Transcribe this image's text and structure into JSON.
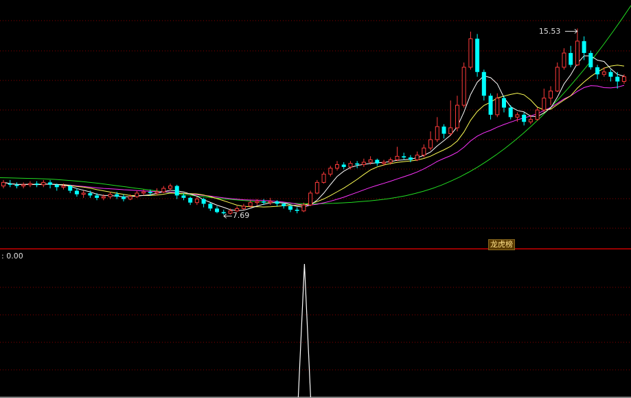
{
  "chart_data": [
    {
      "type": "candlestick",
      "labels": {
        "high": "15.53",
        "low": "7.69",
        "event": "龙虎榜"
      },
      "price_range": [
        6.6,
        16.5
      ],
      "colors": {
        "up": "#ff3b3b",
        "down": "#00ffff",
        "ma5": "#ffffff",
        "ma10": "#ffff55",
        "ma20": "#ff33ff",
        "ma60": "#22dd22",
        "grid": "#8b0000",
        "divider": "#cc0000"
      },
      "candles": [
        [
          8.9,
          9.05,
          9.15,
          8.8
        ],
        [
          9.0,
          8.95,
          9.15,
          8.85
        ],
        [
          8.95,
          8.9,
          9.05,
          8.8
        ],
        [
          8.9,
          8.95,
          9.05,
          8.8
        ],
        [
          8.95,
          9.0,
          9.1,
          8.85
        ],
        [
          9.0,
          8.95,
          9.1,
          8.85
        ],
        [
          8.95,
          9.05,
          9.15,
          8.85
        ],
        [
          9.05,
          8.95,
          9.15,
          8.8
        ],
        [
          8.95,
          8.85,
          9.0,
          8.7
        ],
        [
          8.85,
          8.9,
          9.0,
          8.75
        ],
        [
          8.9,
          8.7,
          8.95,
          8.6
        ],
        [
          8.7,
          8.55,
          8.8,
          8.45
        ],
        [
          8.55,
          8.6,
          8.7,
          8.4
        ],
        [
          8.6,
          8.5,
          8.7,
          8.4
        ],
        [
          8.5,
          8.4,
          8.6,
          8.3
        ],
        [
          8.4,
          8.45,
          8.55,
          8.3
        ],
        [
          8.45,
          8.55,
          8.65,
          8.35
        ],
        [
          8.55,
          8.45,
          8.65,
          8.35
        ],
        [
          8.45,
          8.35,
          8.55,
          8.25
        ],
        [
          8.35,
          8.45,
          8.55,
          8.3
        ],
        [
          8.45,
          8.6,
          8.7,
          8.4
        ],
        [
          8.6,
          8.65,
          8.75,
          8.5
        ],
        [
          8.65,
          8.6,
          8.75,
          8.5
        ],
        [
          8.6,
          8.65,
          8.8,
          8.5
        ],
        [
          8.65,
          8.8,
          8.9,
          8.6
        ],
        [
          8.8,
          8.9,
          9.0,
          8.7
        ],
        [
          8.9,
          8.5,
          8.95,
          8.35
        ],
        [
          8.5,
          8.4,
          8.6,
          8.3
        ],
        [
          8.4,
          8.2,
          8.45,
          8.1
        ],
        [
          8.2,
          8.35,
          8.45,
          8.1
        ],
        [
          8.35,
          8.15,
          8.4,
          8.0
        ],
        [
          8.15,
          7.95,
          8.2,
          7.85
        ],
        [
          7.95,
          7.8,
          8.05,
          7.75
        ],
        [
          7.8,
          7.75,
          7.9,
          7.69
        ],
        [
          7.75,
          7.85,
          7.95,
          7.7
        ],
        [
          7.85,
          7.95,
          8.05,
          7.8
        ],
        [
          7.95,
          8.05,
          8.15,
          7.9
        ],
        [
          8.05,
          8.2,
          8.3,
          8.0
        ],
        [
          8.2,
          8.25,
          8.35,
          8.1
        ],
        [
          8.25,
          8.2,
          8.35,
          8.1
        ],
        [
          8.2,
          8.25,
          8.4,
          8.1
        ],
        [
          8.25,
          8.15,
          8.3,
          8.05
        ],
        [
          8.15,
          8.05,
          8.2,
          7.95
        ],
        [
          8.05,
          7.9,
          8.1,
          7.8
        ],
        [
          7.9,
          7.85,
          8.0,
          7.75
        ],
        [
          7.85,
          8.1,
          8.2,
          7.8
        ],
        [
          8.1,
          8.6,
          8.7,
          8.05
        ],
        [
          8.6,
          9.05,
          9.15,
          8.55
        ],
        [
          9.05,
          9.4,
          9.5,
          9.0
        ],
        [
          9.4,
          9.65,
          9.75,
          9.3
        ],
        [
          9.65,
          9.8,
          9.95,
          9.55
        ],
        [
          9.8,
          9.7,
          9.9,
          9.6
        ],
        [
          9.7,
          9.85,
          9.95,
          9.6
        ],
        [
          9.85,
          9.8,
          9.95,
          9.65
        ],
        [
          9.8,
          9.9,
          10.05,
          9.7
        ],
        [
          9.9,
          10.0,
          10.15,
          9.8
        ],
        [
          10.0,
          9.85,
          10.05,
          9.75
        ],
        [
          9.85,
          9.9,
          10.0,
          9.75
        ],
        [
          9.9,
          10.0,
          10.1,
          9.8
        ],
        [
          10.0,
          10.15,
          10.55,
          9.95
        ],
        [
          10.15,
          10.1,
          10.3,
          10.0
        ],
        [
          10.1,
          10.0,
          10.2,
          9.9
        ],
        [
          10.0,
          10.2,
          10.35,
          9.95
        ],
        [
          10.2,
          10.5,
          10.65,
          10.1
        ],
        [
          10.5,
          10.85,
          11.2,
          10.4
        ],
        [
          10.85,
          11.4,
          11.8,
          10.75
        ],
        [
          11.4,
          11.1,
          11.5,
          10.9
        ],
        [
          11.1,
          11.35,
          12.5,
          11.0
        ],
        [
          11.35,
          12.3,
          12.7,
          11.2
        ],
        [
          12.3,
          13.9,
          14.1,
          12.2
        ],
        [
          13.9,
          15.1,
          15.4,
          13.8
        ],
        [
          15.1,
          13.7,
          15.3,
          13.5
        ],
        [
          13.7,
          12.7,
          13.8,
          12.5
        ],
        [
          12.7,
          11.9,
          12.8,
          11.7
        ],
        [
          11.9,
          12.6,
          12.8,
          11.8
        ],
        [
          12.6,
          12.2,
          12.7,
          12.0
        ],
        [
          12.2,
          11.8,
          12.3,
          11.7
        ],
        [
          11.8,
          11.9,
          12.0,
          11.6
        ],
        [
          11.9,
          11.6,
          12.0,
          11.45
        ],
        [
          11.6,
          11.7,
          11.9,
          11.5
        ],
        [
          11.7,
          12.1,
          12.2,
          11.65
        ],
        [
          12.1,
          12.6,
          13.0,
          12.0
        ],
        [
          12.6,
          12.9,
          13.1,
          12.3
        ],
        [
          12.9,
          13.9,
          14.1,
          12.85
        ],
        [
          13.9,
          14.5,
          14.7,
          13.8
        ],
        [
          14.5,
          14.0,
          14.8,
          13.9
        ],
        [
          14.0,
          15.0,
          15.53,
          13.95
        ],
        [
          15.0,
          14.5,
          15.2,
          14.2
        ],
        [
          14.5,
          13.9,
          14.6,
          13.8
        ],
        [
          13.9,
          13.6,
          14.0,
          13.4
        ],
        [
          13.6,
          13.7,
          13.9,
          13.5
        ],
        [
          13.7,
          13.5,
          13.8,
          13.3
        ],
        [
          13.5,
          13.3,
          13.7,
          13.0
        ],
        [
          13.3,
          13.5,
          13.6,
          13.2
        ]
      ],
      "ma60": [
        9.25,
        9.24,
        9.23,
        9.22,
        9.21,
        9.2,
        9.18,
        9.15,
        9.12,
        9.09,
        9.05,
        9.01,
        8.96,
        8.91,
        8.86,
        8.81,
        8.76,
        8.71,
        8.66,
        8.61,
        8.56,
        8.52,
        8.47,
        8.43,
        8.39,
        8.35,
        8.32,
        8.29,
        8.26,
        8.23,
        8.21,
        8.19,
        8.17,
        8.16,
        8.15,
        8.15,
        8.16,
        8.17,
        8.19,
        8.21,
        8.24,
        8.27,
        8.31,
        8.36,
        8.42,
        8.49,
        8.58,
        8.68,
        8.8,
        8.94,
        9.1,
        9.28,
        9.48,
        9.7,
        9.94,
        10.2,
        10.48,
        10.78,
        11.1,
        11.44,
        11.8,
        12.18,
        12.58,
        13.0,
        13.44,
        13.9,
        14.38,
        14.88,
        15.4,
        15.94,
        16.5
      ]
    },
    {
      "type": "line",
      "title": ": 0.00",
      "y_range": [
        0,
        1
      ],
      "spike_index": 45,
      "values_note": "0 everywhere except 1 at the spike bar"
    }
  ]
}
